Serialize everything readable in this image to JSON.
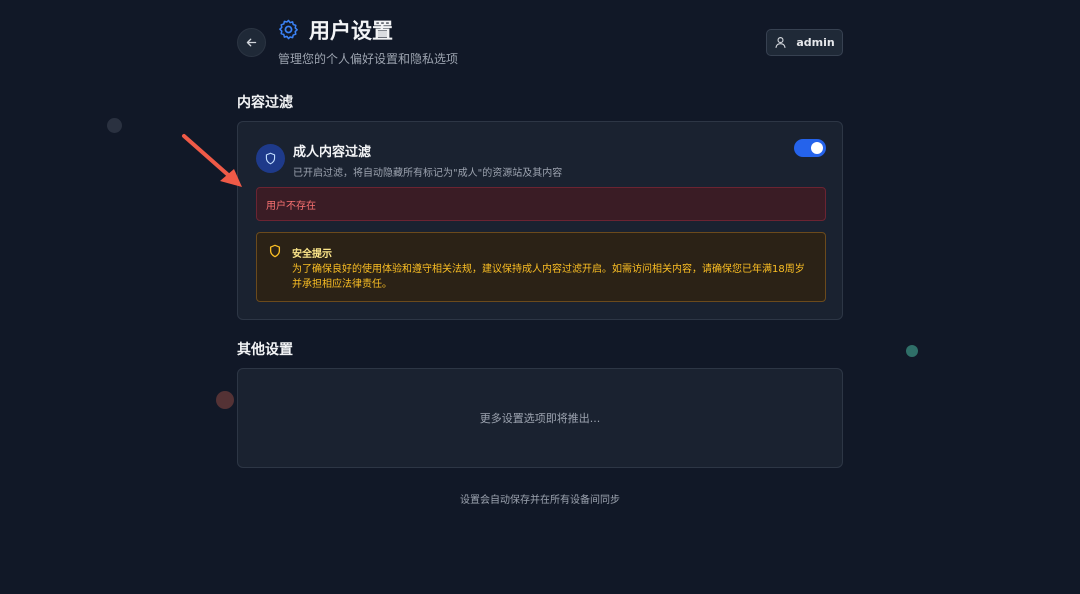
{
  "header": {
    "title": "用户设置",
    "subtitle": "管理您的个人偏好设置和隐私选项",
    "user": "admin",
    "icons": {
      "back": "arrow-left-icon",
      "title": "gear-icon",
      "user": "user-icon"
    }
  },
  "content_filter": {
    "heading": "内容过滤",
    "title": "成人内容过滤",
    "description": "已开启过滤，将自动隐藏所有标记为\"成人\"的资源站及其内容",
    "toggle_on": true,
    "error": "用户不存在",
    "warning_title": "安全提示",
    "warning_text": "为了确保良好的使用体验和遵守相关法规，建议保持成人内容过滤开启。如需访问相关内容，请确保您已年满18周岁并承担相应法律责任。",
    "icons": {
      "filter": "shield-icon",
      "warning": "shield-warning-icon"
    }
  },
  "other_settings": {
    "heading": "其他设置",
    "placeholder": "更多设置选项即将推出..."
  },
  "footer": "设置会自动保存并在所有设备间同步",
  "colors": {
    "background": "#111827",
    "accent": "#2563eb",
    "error": "#f87171",
    "warning": "#fbbf24",
    "annotation_arrow": "#ef5a47"
  }
}
